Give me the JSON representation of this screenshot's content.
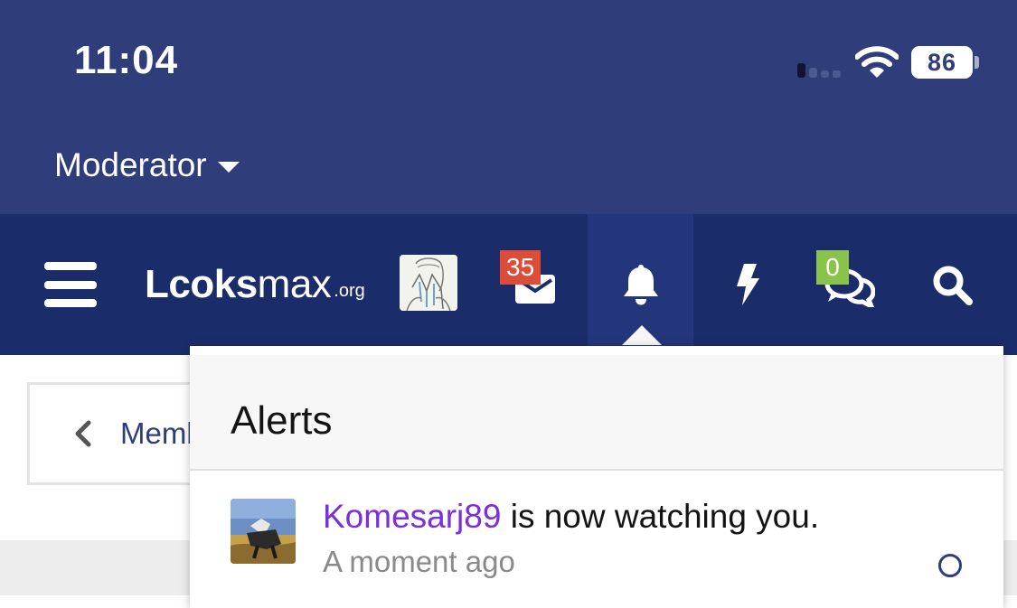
{
  "status_bar": {
    "time": "11:04",
    "battery": "86"
  },
  "subheader": {
    "role_label": "Moderator"
  },
  "navbar": {
    "logo_main": "Lcoks",
    "logo_thin": "max",
    "logo_tld": ".org",
    "inbox_count": "35",
    "chat_count": "0"
  },
  "page": {
    "back_label": "Memb"
  },
  "alerts": {
    "title": "Alerts",
    "items": [
      {
        "user": "Komesarj89",
        "text": " is now watching you.",
        "time": "A moment ago"
      }
    ]
  },
  "colors": {
    "header_bg": "#2f3e7b",
    "navbar_bg": "#1b2c6a",
    "username": "#7b2ee0",
    "badge_red": "#dd4b39",
    "badge_green": "#8bc34a"
  },
  "icons": [
    "hamburger-icon",
    "envelope-icon",
    "bell-icon",
    "bolt-icon",
    "chat-icon",
    "search-icon",
    "chevron-left-icon",
    "wifi-icon",
    "signal-icon"
  ]
}
